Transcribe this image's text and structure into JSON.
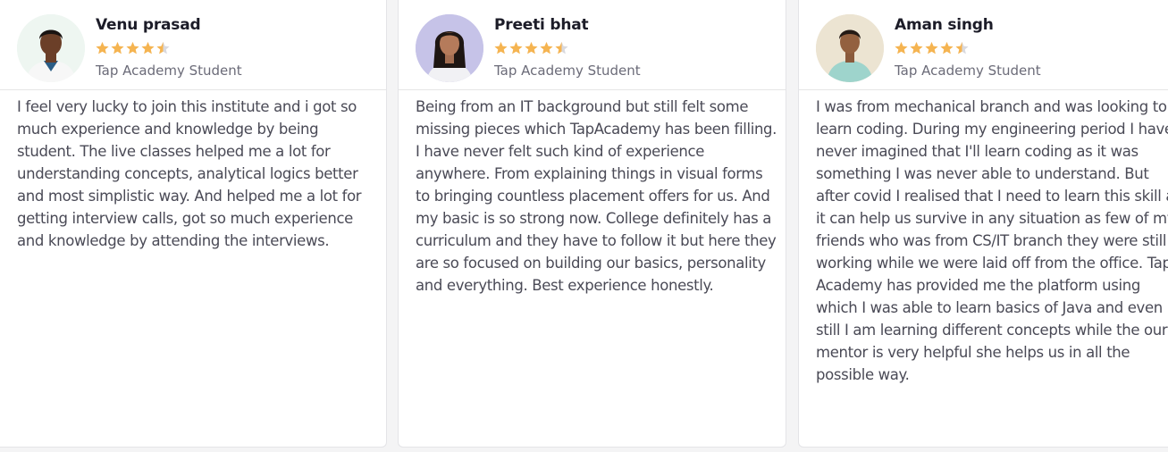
{
  "testimonials": [
    {
      "name": "Venu prasad",
      "role": "Tap Academy Student",
      "rating": 4.5,
      "avatar": "avatar-male-portrait",
      "review": "I feel very lucky to join this institute and i got so much experience and knowledge by being student. The live classes helped me a lot for understanding concepts, analytical logics better and most simplistic way. And helped me a lot for getting interview calls, got so much experience and knowledge by attending the interviews."
    },
    {
      "name": "Preeti bhat",
      "role": "Tap Academy Student",
      "rating": 4.5,
      "avatar": "avatar-female-portrait",
      "review": "Being from an IT background but still felt some missing pieces which TapAcademy has been filling. I have never felt such kind of experience anywhere. From explaining things in visual forms to bringing countless placement offers for us. And my basic is so strong now. College definitely has a curriculum and they have to follow it but here they are so focused on building our basics, personality and everything. Best experience honestly."
    },
    {
      "name": "Aman singh",
      "role": "Tap Academy Student",
      "rating": 4.5,
      "avatar": "avatar-male-portrait",
      "review": "I was from mechanical branch and was looking to learn coding. During my engineering period I have never imagined that I'll learn coding as it was something I was never able to understand. But after covid I realised that I need to learn this skill as it can help us survive in any situation as few of my friends who was from CS/IT branch they were still working while we were laid off from the office. Tap Academy has provided me the platform using which I was able to learn basics of Java and even still I am learning different concepts while the our mentor is very helpful she helps us in all the possible way."
    }
  ],
  "colors": {
    "star_filled": "#f5b451",
    "star_empty": "#d9d9de",
    "name_text": "#1c1c28",
    "body_text": "#4a4a56"
  }
}
